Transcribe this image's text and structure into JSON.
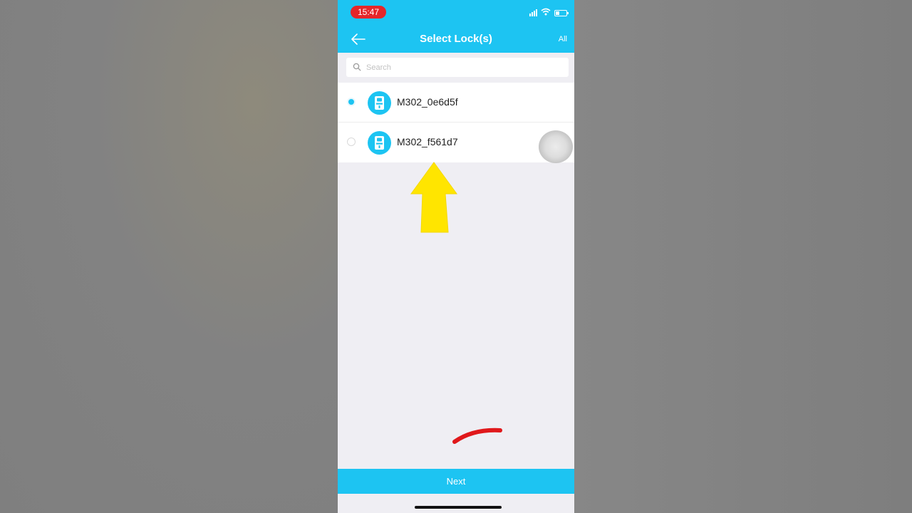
{
  "status_bar": {
    "time": "15:47"
  },
  "nav": {
    "title": "Select Lock(s)",
    "all_label": "All"
  },
  "search": {
    "placeholder": "Search",
    "value": ""
  },
  "locks": [
    {
      "name": "M302_0e6d5f",
      "selected": true
    },
    {
      "name": "M302_f561d7",
      "selected": false
    }
  ],
  "footer": {
    "next_label": "Next"
  },
  "colors": {
    "accent": "#1dc4f2",
    "time_pill": "#e5262a",
    "annotation_arrow": "#ffe500",
    "annotation_stroke": "#e0181b"
  }
}
